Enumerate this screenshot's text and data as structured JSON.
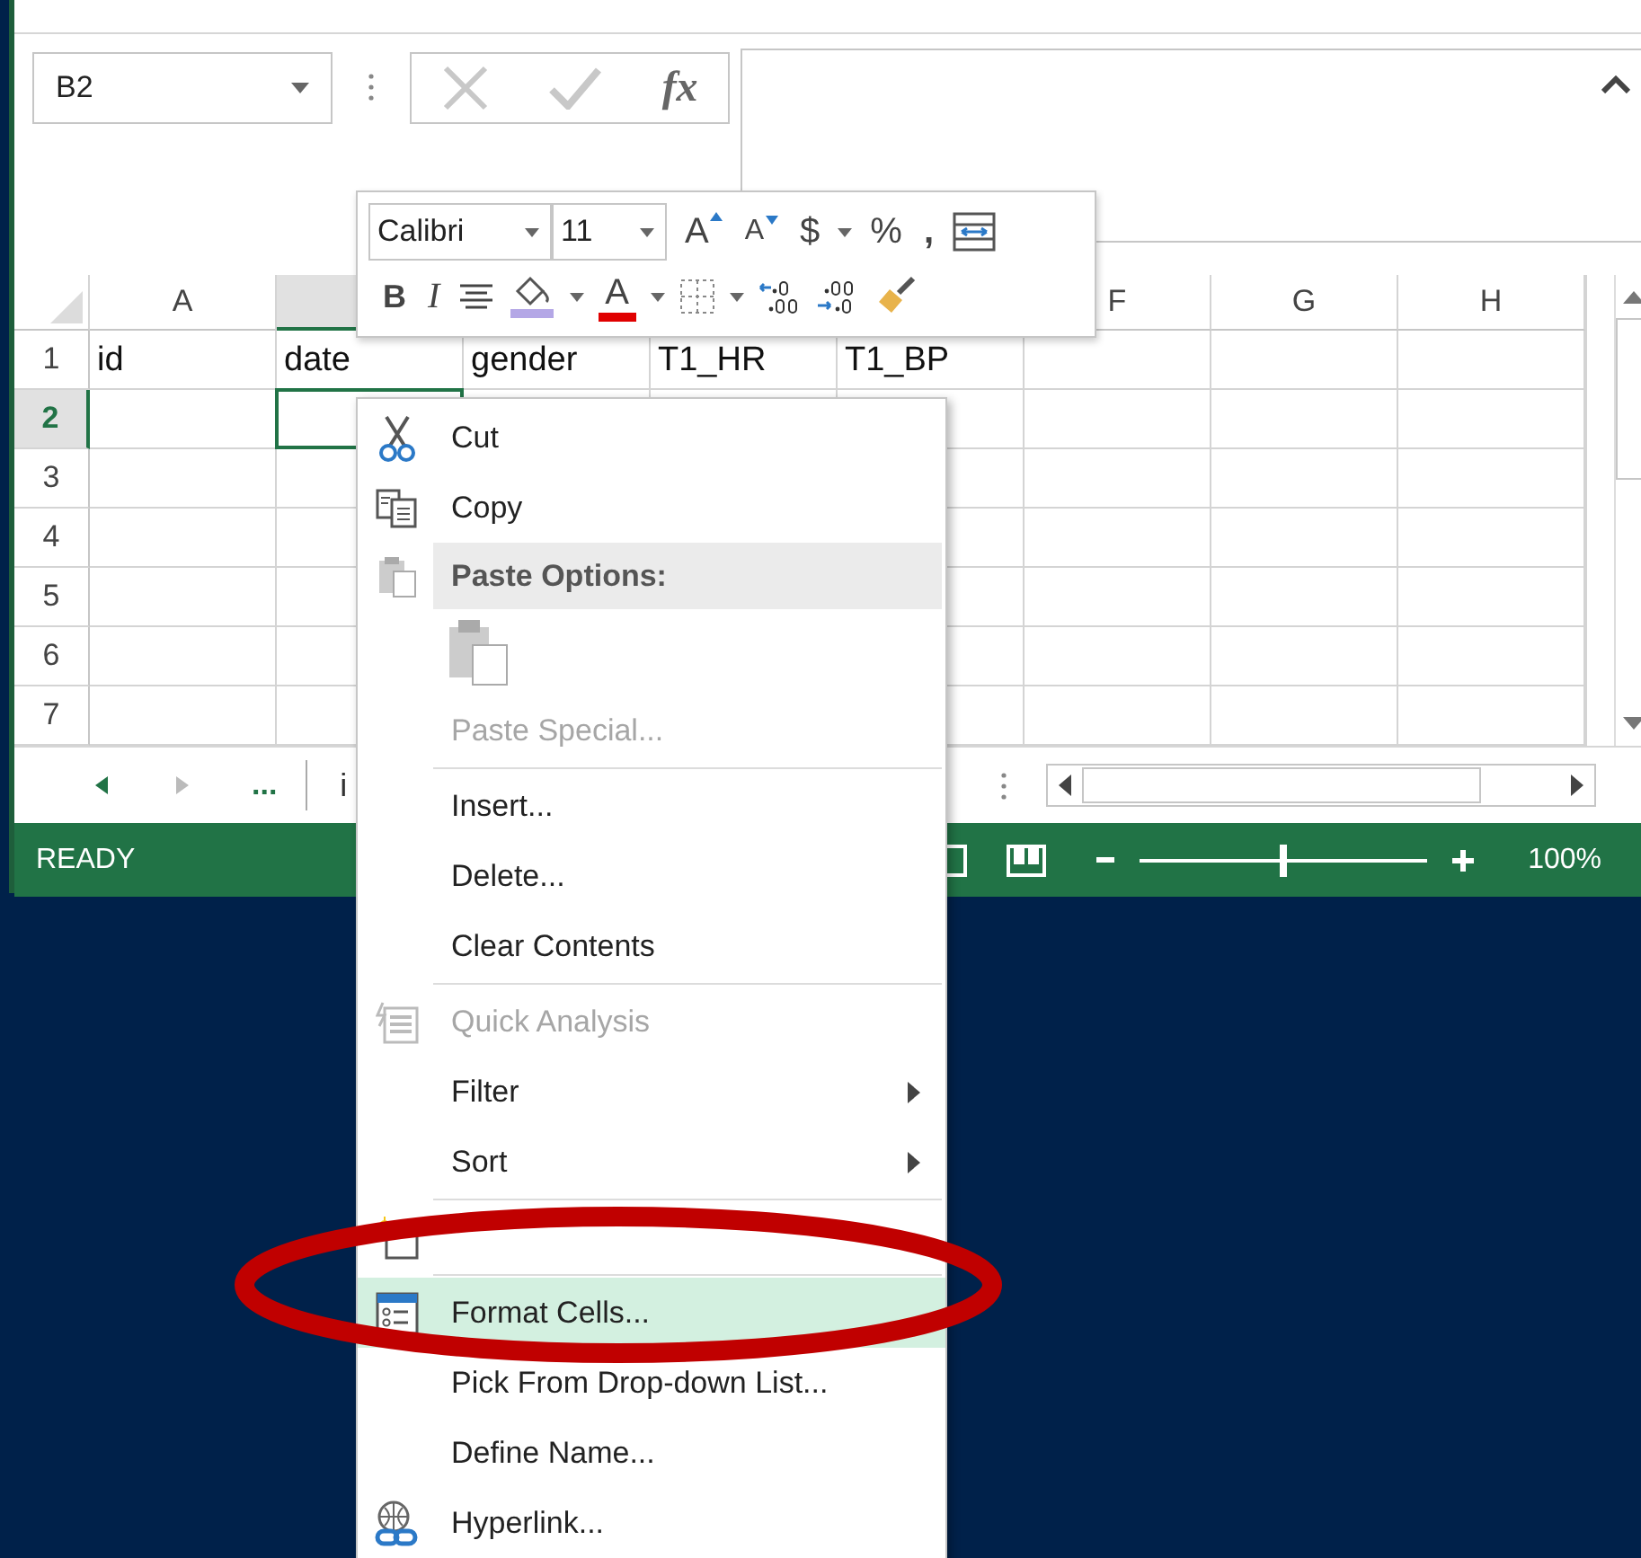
{
  "name_box": {
    "value": "B2"
  },
  "formula_bar": {
    "function_label": "fx"
  },
  "grid": {
    "columns": [
      {
        "label": "A",
        "selected": false
      },
      {
        "selected": true
      },
      {
        "selected": false
      },
      {
        "selected": false
      },
      {
        "selected": false
      },
      {
        "label": "F",
        "selected": false
      },
      {
        "label": "G",
        "selected": false
      },
      {
        "label": "H",
        "selected": false
      }
    ],
    "rows": [
      {
        "label": "1",
        "selected": false,
        "cells": [
          "id",
          "date",
          "gender",
          "T1_HR",
          "T1_BP"
        ]
      },
      {
        "label": "2",
        "selected": true
      },
      {
        "label": "3",
        "selected": false
      },
      {
        "label": "4",
        "selected": false
      },
      {
        "label": "5",
        "selected": false
      },
      {
        "label": "6",
        "selected": false
      },
      {
        "label": "7",
        "selected": false
      }
    ]
  },
  "sheet_bar": {
    "more": "...",
    "tabs": [
      "i"
    ]
  },
  "status_bar": {
    "mode": "READY",
    "zoom": {
      "level": 0.5,
      "label": "100%"
    }
  },
  "mini_toolbar": {
    "font": "Calibri",
    "size": "11",
    "row_1": [
      {
        "kind": "grow-font",
        "label": "A"
      },
      {
        "kind": "shrink-font",
        "label": "A"
      },
      {
        "kind": "currency",
        "label": "$",
        "dropdown": true
      },
      {
        "kind": "percent",
        "label": "%"
      },
      {
        "kind": "comma",
        "label": ","
      },
      {
        "kind": "wrap"
      }
    ],
    "row_2": [
      {
        "kind": "bold",
        "label": "B"
      },
      {
        "kind": "italic",
        "label": "I"
      },
      {
        "kind": "center"
      },
      {
        "kind": "fill-color",
        "dropdown": true
      },
      {
        "kind": "font-color",
        "label": "A",
        "dropdown": true
      },
      {
        "kind": "borders",
        "dropdown": true
      },
      {
        "kind": "increase-decimal"
      },
      {
        "kind": "decrease-decimal"
      },
      {
        "kind": "format-painter"
      }
    ]
  },
  "context_menu": {
    "items": [
      {
        "kind": "command",
        "label": "Cut",
        "disabled": false,
        "selected": false
      },
      {
        "kind": "command",
        "label": "Copy",
        "disabled": false,
        "selected": false
      },
      {
        "kind": "header",
        "label": "Paste Options:"
      },
      {
        "kind": "paste-icons",
        "disabled": true
      },
      {
        "kind": "command",
        "label": "Paste Special...",
        "disabled": true,
        "selected": false
      },
      {
        "kind": "separator"
      },
      {
        "kind": "command",
        "label": "Insert...",
        "disabled": false,
        "selected": false
      },
      {
        "kind": "command",
        "label": "Delete...",
        "disabled": false,
        "selected": false
      },
      {
        "kind": "command",
        "label": "Clear Contents",
        "disabled": false,
        "selected": false
      },
      {
        "kind": "separator"
      },
      {
        "kind": "command",
        "label": "Quick Analysis",
        "disabled": true,
        "selected": false
      },
      {
        "kind": "command",
        "label": "Filter",
        "disabled": false,
        "selected": false,
        "submenu": true
      },
      {
        "kind": "command",
        "label": "Sort",
        "disabled": false,
        "selected": false,
        "submenu": true
      },
      {
        "kind": "separator"
      },
      {
        "kind": "command",
        "selected": false
      },
      {
        "kind": "separator"
      },
      {
        "kind": "command",
        "label": "Format Cells...",
        "disabled": false,
        "selected": true
      },
      {
        "kind": "command",
        "label": "Pick From Drop-down List...",
        "disabled": false,
        "selected": false
      },
      {
        "kind": "command",
        "label": "Define Name...",
        "disabled": false,
        "selected": false
      },
      {
        "kind": "command",
        "label": "Hyperlink...",
        "disabled": false,
        "selected": false
      }
    ]
  }
}
